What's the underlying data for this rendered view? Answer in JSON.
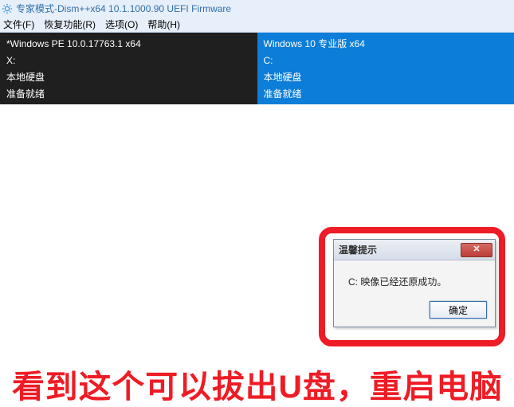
{
  "titlebar": {
    "title": "专家模式-Dism++x64 10.1.1000.90 UEFI Firmware"
  },
  "menubar": {
    "file": "文件(F)",
    "recover": "恢复功能(R)",
    "options": "选项(O)",
    "help": "帮助(H)"
  },
  "panels": {
    "left": {
      "line1": "*Windows PE 10.0.17763.1 x64",
      "line2": "X:",
      "line3": "本地硬盘",
      "line4": "准备就绪"
    },
    "right": {
      "line1": "Windows 10 专业版 x64",
      "line2": "C:",
      "line3": "本地硬盘",
      "line4": "准备就绪"
    }
  },
  "dialog": {
    "title": "温馨提示",
    "body": "C: 映像已经还原成功。",
    "ok": "确定"
  },
  "caption": "看到这个可以拔出U盘，重启电脑"
}
